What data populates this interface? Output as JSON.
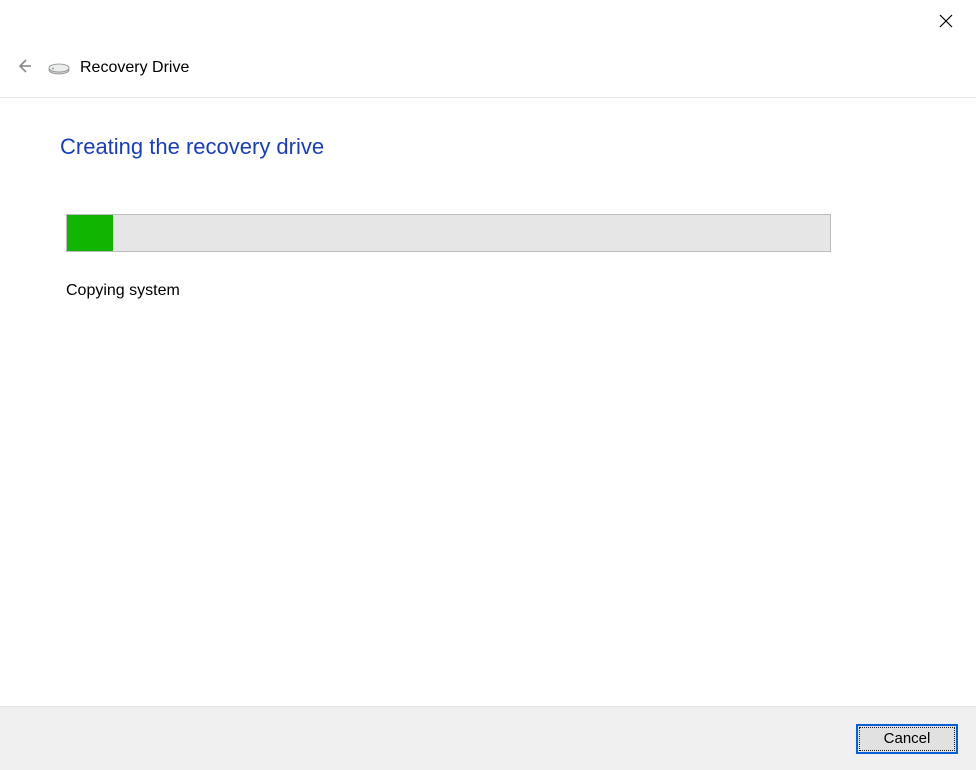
{
  "window": {
    "app_title": "Recovery Drive"
  },
  "page": {
    "heading": "Creating the recovery drive",
    "status_text": "Copying system",
    "progress_percent": 6
  },
  "buttons": {
    "cancel": "Cancel"
  },
  "icons": {
    "close": "close-icon",
    "back": "back-arrow-icon",
    "drive": "drive-icon"
  }
}
